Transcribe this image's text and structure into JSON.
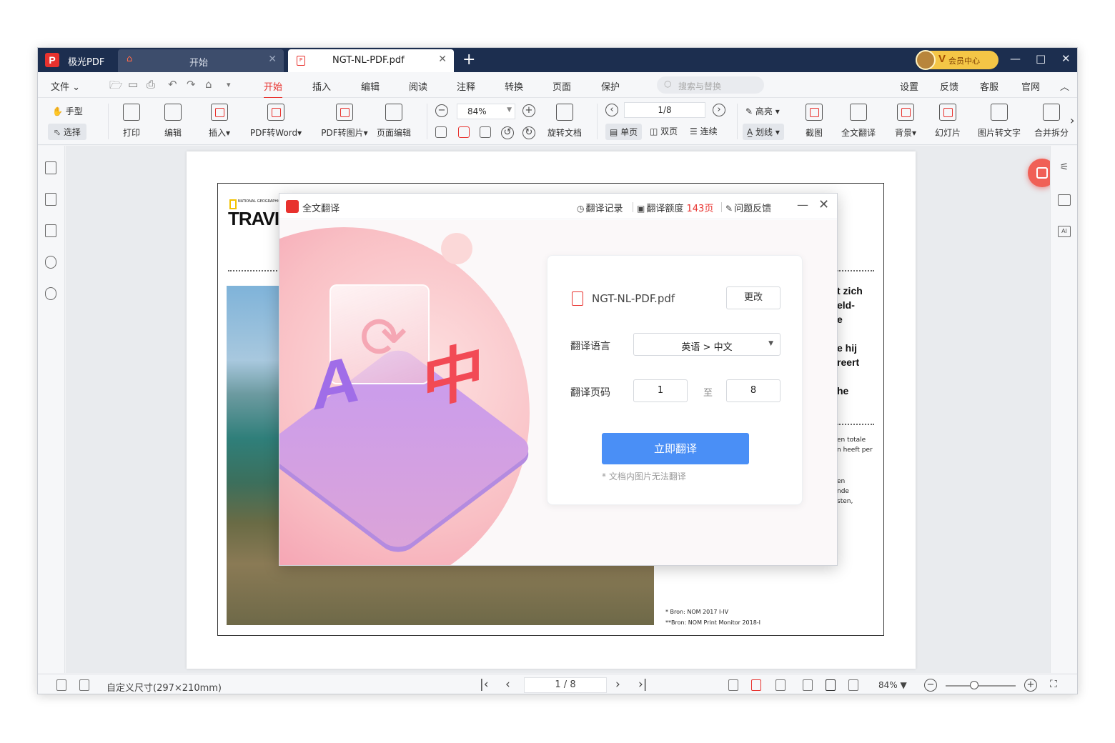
{
  "titlebar": {
    "app_name": "极光PDF",
    "tabs": [
      {
        "label": "开始"
      },
      {
        "label": "NGT-NL-PDF.pdf"
      }
    ],
    "new_tab": "+",
    "vip_label": "会员中心",
    "vip_badge": "V",
    "window_buttons": {
      "minimize": "—",
      "maximize": "□",
      "close": "✕"
    }
  },
  "menubar": {
    "file": "文件",
    "items": [
      "开始",
      "插入",
      "编辑",
      "阅读",
      "注释",
      "转换",
      "页面",
      "保护"
    ],
    "active_item": "开始",
    "search_placeholder": "搜索与替换",
    "right_items": [
      "设置",
      "反馈",
      "客服",
      "官网"
    ]
  },
  "ribbon": {
    "hand_tool": "手型",
    "select_tool": "选择",
    "buttons": {
      "print": "打印",
      "edit": "编辑",
      "insert": "插入",
      "pdf_to_word": "PDF转Word",
      "pdf_to_image": "PDF转图片",
      "page_edit": "页面编辑",
      "rotate_doc": "旋转文档",
      "screenshot": "截图",
      "full_translate": "全文翻译",
      "background": "背景",
      "slideshow": "幻灯片",
      "image_to_text": "图片转文字",
      "merge_split": "合并拆分"
    },
    "zoom_value": "84%",
    "page_value": "1/8",
    "view_single": "单页",
    "view_double": "双页",
    "view_continuous": "连续",
    "highlight": "高亮",
    "underline": "划线"
  },
  "document": {
    "ng_brand_small": "NATIONAL GEOGRAPHIC",
    "ng_title_fragment": "TRAVI",
    "right_fragments": [
      "t zich",
      "eld-",
      "e",
      "e hij",
      "reert",
      "he"
    ],
    "small_fragments": [
      "en totale",
      "n heeft per",
      "en",
      "nde",
      "sten,"
    ],
    "footnotes": [
      "* Bron: NOM 2017 I-IV",
      "**Bron: NOM Print Monitor 2018-I"
    ]
  },
  "dialog": {
    "title": "全文翻译",
    "history": "翻译记录",
    "quota_label": "翻译额度",
    "quota_value": "143页",
    "feedback": "问题反馈",
    "file_name": "NGT-NL-PDF.pdf",
    "change_button": "更改",
    "lang_label": "翻译语言",
    "lang_value": "英语 > 中文",
    "page_label": "翻译页码",
    "page_from": "1",
    "page_to_label": "至",
    "page_to": "8",
    "submit": "立即翻译",
    "note": "* 文档内图片无法翻译",
    "illustration_a": "A",
    "illustration_zh": "中"
  },
  "statusbar": {
    "page_size": "自定义尺寸(297×210mm)",
    "page_indicator": "1 / 8",
    "zoom": "84%"
  }
}
